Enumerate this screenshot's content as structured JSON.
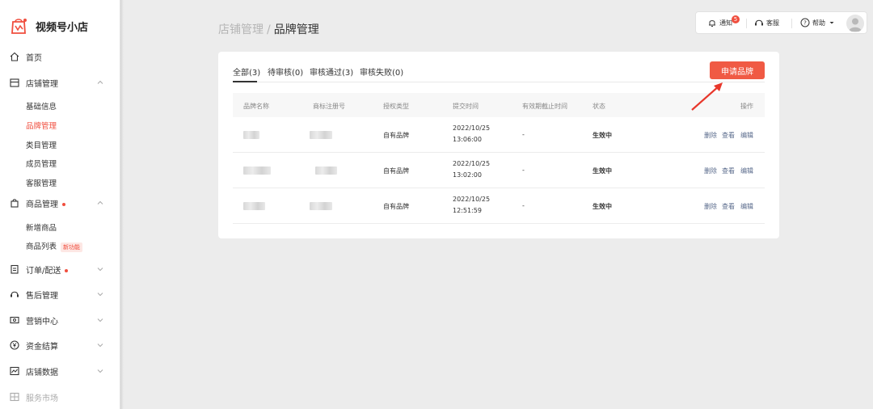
{
  "app": {
    "name": "视频号小店"
  },
  "sidebar": {
    "home": "首页",
    "store_mgmt": {
      "label": "店铺管理",
      "children": [
        "基础信息",
        "品牌管理",
        "类目管理",
        "成员管理",
        "客服管理"
      ]
    },
    "product_mgmt": {
      "label": "商品管理",
      "children": [
        "新增商品",
        "商品列表"
      ],
      "new_badge": "新功能"
    },
    "orders": "订单/配送",
    "after_sales": "售后管理",
    "marketing": "营销中心",
    "settlement": "资金结算",
    "store_data": "店铺数据",
    "service_market": "服务市场"
  },
  "topbar": {
    "notify": "通知",
    "notify_count": "5",
    "service": "客服",
    "help": "帮助"
  },
  "breadcrumb": {
    "parent": "店铺管理",
    "separator": "/",
    "current": "品牌管理"
  },
  "tabs": [
    "全部(3)",
    "待审核(0)",
    "审核通过(3)",
    "审核失败(0)"
  ],
  "apply_button": "申请品牌",
  "table": {
    "headers": [
      "品牌名称",
      "商标注册号",
      "授权类型",
      "提交时间",
      "有效期截止时间",
      "状态",
      "操作"
    ],
    "rows": [
      {
        "auth_type": "自有品牌",
        "date": "2022/10/25",
        "time": "13:06:00",
        "expiry": "-",
        "status": "生效中"
      },
      {
        "auth_type": "自有品牌",
        "date": "2022/10/25",
        "time": "13:02:00",
        "expiry": "-",
        "status": "生效中"
      },
      {
        "auth_type": "自有品牌",
        "date": "2022/10/25",
        "time": "12:51:59",
        "expiry": "-",
        "status": "生效中"
      }
    ],
    "actions": [
      "删除",
      "查看",
      "编辑"
    ]
  },
  "colors": {
    "accent": "#f05a44",
    "active_nav": "#f04e3e",
    "action_link": "#5a6b8c"
  }
}
